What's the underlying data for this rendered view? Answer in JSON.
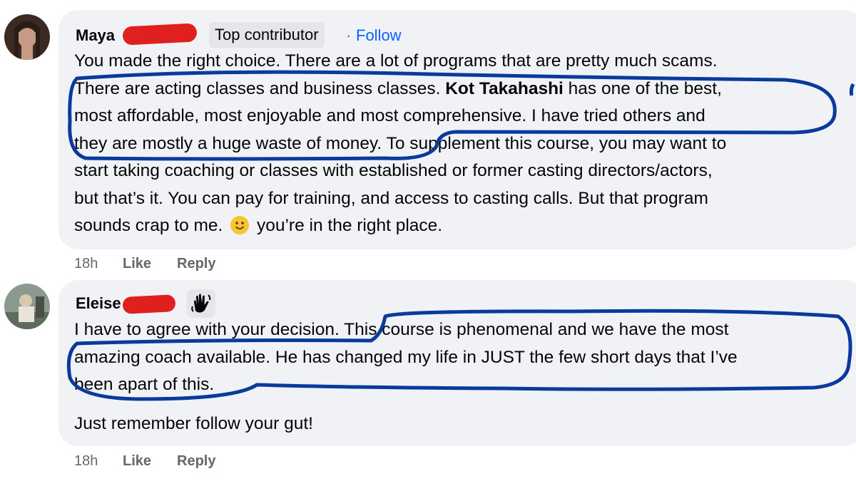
{
  "comments": [
    {
      "author": "Maya",
      "badge": "Top contributor",
      "separator": "·",
      "follow": "Follow",
      "lines": [
        "You made the right choice. There are a lot of programs that are pretty much scams.",
        [
          "There are acting classes and business classes. ",
          "Kot Takahashi",
          " has one of the best,"
        ],
        "most affordable, most enjoyable and most comprehensive. I have tried others and",
        "they are mostly a huge waste of money. To supplement this course, you may want to",
        "start taking coaching or classes with established or former casting directors/actors,",
        "but that’s it. You can pay for training, and access to casting calls. But that program",
        [
          "sounds crap to me. ",
          "smile-emoji",
          " you’re in the right place."
        ]
      ],
      "time": "18h",
      "like": "Like",
      "reply": "Reply"
    },
    {
      "author": "Eleise",
      "badge_icon": "wave-hand-icon",
      "lines": [
        "I have to agree with your decision. This course is phenomenal and we have the most",
        "amazing coach available. He has changed my life in JUST the few short days that I’ve",
        "been apart of this.",
        "Just remember follow your gut!"
      ],
      "time": "18h",
      "like": "Like",
      "reply": "Reply"
    }
  ],
  "colors": {
    "bubble": "#f0f2f5",
    "follow": "#0866ff",
    "redaction": "#e01f1f",
    "annotation": "#0a3a9c"
  }
}
